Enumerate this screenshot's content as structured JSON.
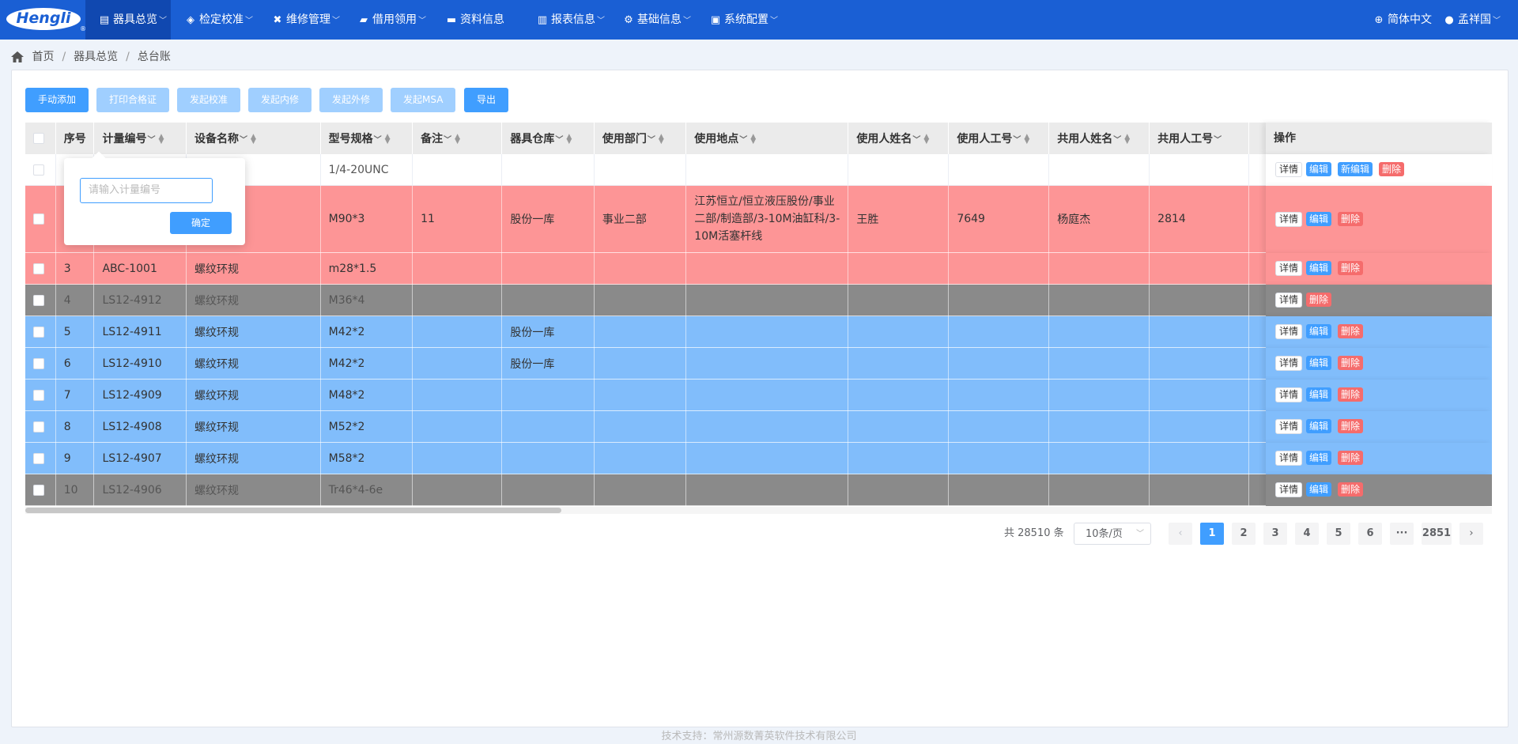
{
  "brand": {
    "logo_text": "Hengli",
    "registered": "®"
  },
  "nav": [
    {
      "label": "器具总览",
      "icon": "chart-icon",
      "active": true
    },
    {
      "label": "检定校准",
      "icon": "layers-icon"
    },
    {
      "label": "维修管理",
      "icon": "wrench-icon"
    },
    {
      "label": "借用领用",
      "icon": "truck-icon"
    },
    {
      "label": "资料信息",
      "icon": "book-icon"
    },
    {
      "label": "报表信息",
      "icon": "bar-chart-icon"
    },
    {
      "label": "基础信息",
      "icon": "gear-icon"
    },
    {
      "label": "系统配置",
      "icon": "monitor-icon"
    }
  ],
  "header_right": {
    "language": "简体中文",
    "user": "孟祥国"
  },
  "breadcrumb": [
    "首页",
    "器具总览",
    "总台账"
  ],
  "toolbar": {
    "add": "手动添加",
    "print_cert": "打印合格证",
    "calibrate": "发起校准",
    "internal_repair": "发起内修",
    "external_repair": "发起外修",
    "msa": "发起MSA",
    "export": "导出"
  },
  "table": {
    "columns": [
      "序号",
      "计量编号",
      "设备名称",
      "型号规格",
      "备注",
      "器具仓库",
      "使用部门",
      "使用地点",
      "使用人姓名",
      "使用人工号",
      "共用人姓名",
      "共用人工号"
    ],
    "ops_header": "操作",
    "rows": [
      {
        "seq": "",
        "code": "",
        "name": "",
        "model": "1/4-20UNC",
        "remark": "",
        "warehouse": "",
        "dept": "",
        "location": "",
        "user": "",
        "user_no": "",
        "co_user": "",
        "co_user_no": "",
        "actions": [
          "详情",
          "编辑",
          "新编辑",
          "删除"
        ]
      },
      {
        "seq": "",
        "code": "",
        "name": "",
        "model": "M90*3",
        "remark": "11",
        "warehouse": "股份一库",
        "dept": "事业二部",
        "location": "江苏恒立/恒立液压股份/事业二部/制造部/3-10M油缸科/3-10M活塞杆线",
        "user": "王胜",
        "user_no": "7649",
        "co_user": "杨庭杰",
        "co_user_no": "2814",
        "actions": [
          "详情",
          "编辑",
          "删除"
        ]
      },
      {
        "seq": "3",
        "code": "ABC-1001",
        "name": "螺纹环规",
        "model": "m28*1.5",
        "remark": "",
        "warehouse": "",
        "dept": "",
        "location": "",
        "user": "",
        "user_no": "",
        "co_user": "",
        "co_user_no": "",
        "actions": [
          "详情",
          "编辑",
          "删除"
        ]
      },
      {
        "seq": "4",
        "code": "LS12-4912",
        "name": "螺纹环规",
        "model": "M36*4",
        "remark": "",
        "warehouse": "",
        "dept": "",
        "location": "",
        "user": "",
        "user_no": "",
        "co_user": "",
        "co_user_no": "",
        "actions": [
          "详情",
          "删除"
        ]
      },
      {
        "seq": "5",
        "code": "LS12-4911",
        "name": "螺纹环规",
        "model": "M42*2",
        "remark": "",
        "warehouse": "股份一库",
        "dept": "",
        "location": "",
        "user": "",
        "user_no": "",
        "co_user": "",
        "co_user_no": "",
        "actions": [
          "详情",
          "编辑",
          "删除"
        ]
      },
      {
        "seq": "6",
        "code": "LS12-4910",
        "name": "螺纹环规",
        "model": "M42*2",
        "remark": "",
        "warehouse": "股份一库",
        "dept": "",
        "location": "",
        "user": "",
        "user_no": "",
        "co_user": "",
        "co_user_no": "",
        "actions": [
          "详情",
          "编辑",
          "删除"
        ]
      },
      {
        "seq": "7",
        "code": "LS12-4909",
        "name": "螺纹环规",
        "model": "M48*2",
        "remark": "",
        "warehouse": "",
        "dept": "",
        "location": "",
        "user": "",
        "user_no": "",
        "co_user": "",
        "co_user_no": "",
        "actions": [
          "详情",
          "编辑",
          "删除"
        ]
      },
      {
        "seq": "8",
        "code": "LS12-4908",
        "name": "螺纹环规",
        "model": "M52*2",
        "remark": "",
        "warehouse": "",
        "dept": "",
        "location": "",
        "user": "",
        "user_no": "",
        "co_user": "",
        "co_user_no": "",
        "actions": [
          "详情",
          "编辑",
          "删除"
        ]
      },
      {
        "seq": "9",
        "code": "LS12-4907",
        "name": "螺纹环规",
        "model": "M58*2",
        "remark": "",
        "warehouse": "",
        "dept": "",
        "location": "",
        "user": "",
        "user_no": "",
        "co_user": "",
        "co_user_no": "",
        "actions": [
          "详情",
          "编辑",
          "删除"
        ]
      },
      {
        "seq": "10",
        "code": "LS12-4906",
        "name": "螺纹环规",
        "model": "Tr46*4-6e",
        "remark": "",
        "warehouse": "",
        "dept": "",
        "location": "",
        "user": "",
        "user_no": "",
        "co_user": "",
        "co_user_no": "",
        "actions": [
          "详情",
          "编辑",
          "删除"
        ]
      }
    ]
  },
  "popover": {
    "placeholder": "请输入计量编号",
    "confirm": "确定"
  },
  "pagination": {
    "total_text": "共 28510 条",
    "page_size": "10条/页",
    "pages": [
      "1",
      "2",
      "3",
      "4",
      "5",
      "6"
    ],
    "ellipsis": "···",
    "last_page": "2851",
    "current": "1"
  },
  "footer": "技术支持：常州源数菁英软件技术有限公司",
  "colors": {
    "nav_bg": "#1a5fd4",
    "primary": "#409eff",
    "row_red": "#fd9596",
    "row_gray": "#8a8a8a",
    "row_blue": "#81bdfb",
    "danger": "#f56c6c"
  }
}
